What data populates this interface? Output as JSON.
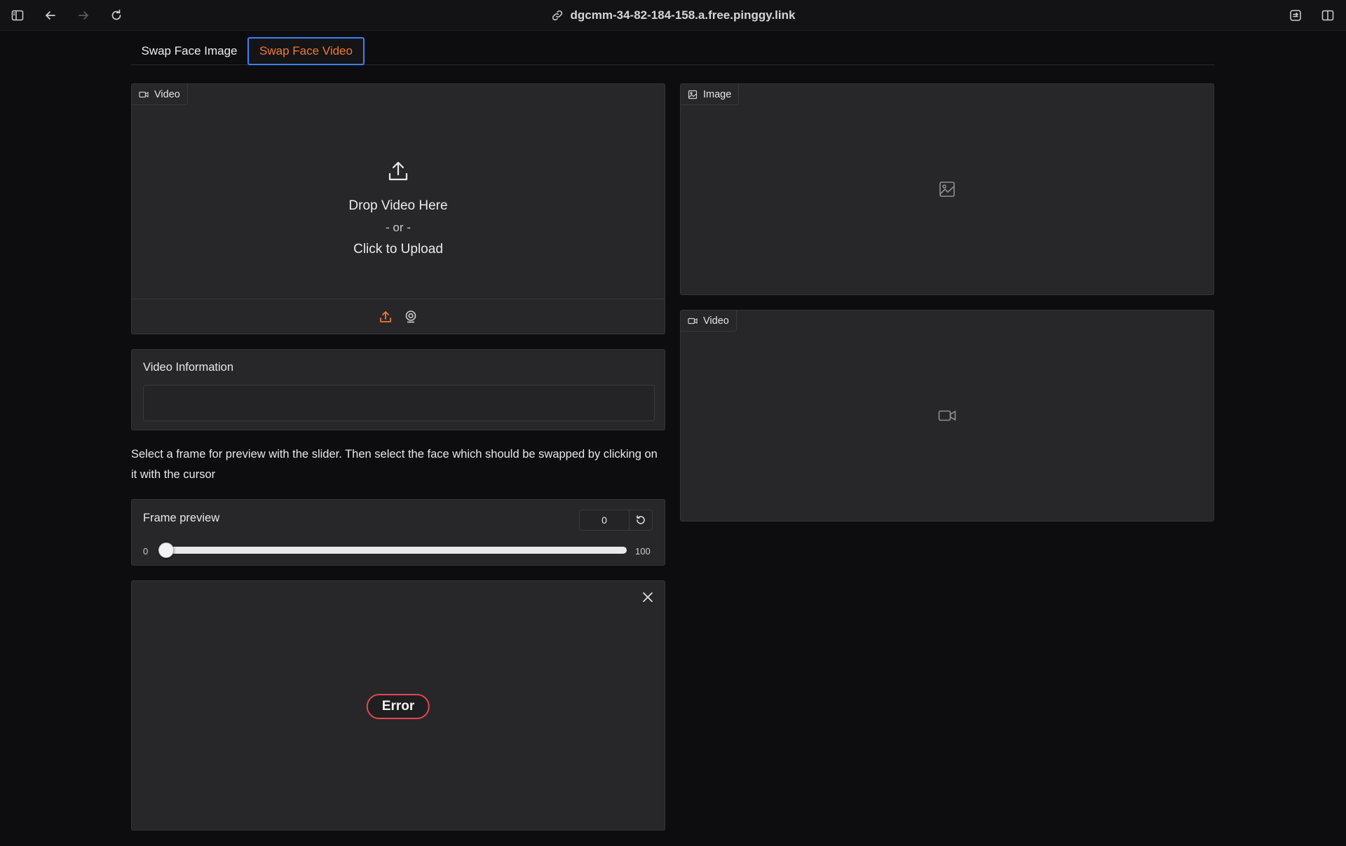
{
  "browser": {
    "url": "dgcmm-34-82-184-158.a.free.pinggy.link",
    "icons": [
      "sidebar-icon",
      "back-arrow-icon",
      "forward-arrow-icon",
      "reload-icon",
      "link-icon",
      "extension-icon",
      "split-view-icon"
    ]
  },
  "tabs": [
    {
      "label": "Swap Face Image",
      "active": false
    },
    {
      "label": "Swap Face Video",
      "active": true
    }
  ],
  "video_input": {
    "label": "Video",
    "drop_text": "Drop Video Here",
    "or_text": "- or -",
    "click_text": "Click to Upload"
  },
  "video_info": {
    "label": "Video Information",
    "value": ""
  },
  "description": "Select a frame for preview with the slider. Then select the face which should be swapped by clicking on it with the cursor",
  "frame_preview": {
    "label": "Frame preview",
    "value": "0",
    "min": "0",
    "max": "100",
    "fraction": 0
  },
  "error": {
    "text": "Error"
  },
  "image_output": {
    "label": "Image"
  },
  "video_output": {
    "label": "Video"
  },
  "colors": {
    "accent_orange": "#f07a2e",
    "active_tab_border": "#3b82f6",
    "error_red": "#e5484d",
    "panel_bg": "#27272a",
    "page_bg": "#0d0d0f"
  }
}
